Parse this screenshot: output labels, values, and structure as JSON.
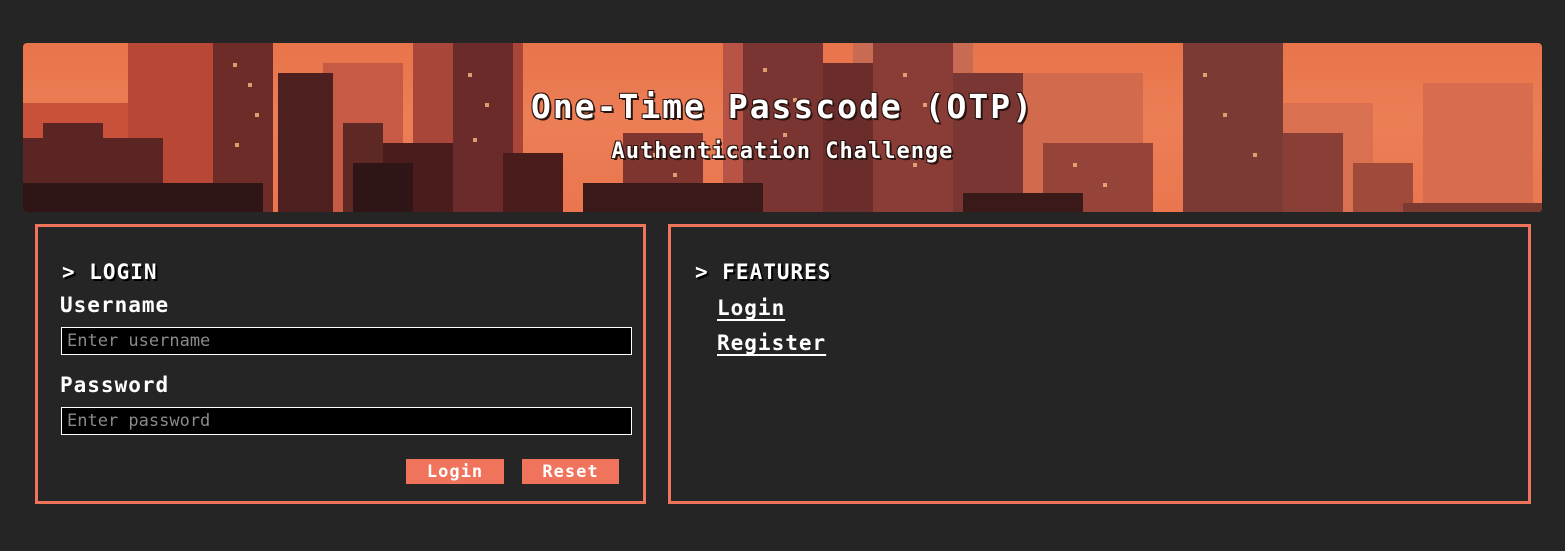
{
  "banner": {
    "title": "One-Time Passcode (OTP)",
    "subtitle": "Authentication Challenge"
  },
  "login_panel": {
    "heading": "> LOGIN",
    "username_label": "Username",
    "username_placeholder": "Enter username",
    "password_label": "Password",
    "password_placeholder": "Enter password",
    "login_button": "Login",
    "reset_button": "Reset"
  },
  "features_panel": {
    "heading": "> FEATURES",
    "links": [
      {
        "label": "Login"
      },
      {
        "label": "Register"
      }
    ]
  },
  "colors": {
    "page_background": "#252525",
    "accent": "#f0735c",
    "banner_sky": "#ec7e55",
    "input_background": "#000000"
  }
}
